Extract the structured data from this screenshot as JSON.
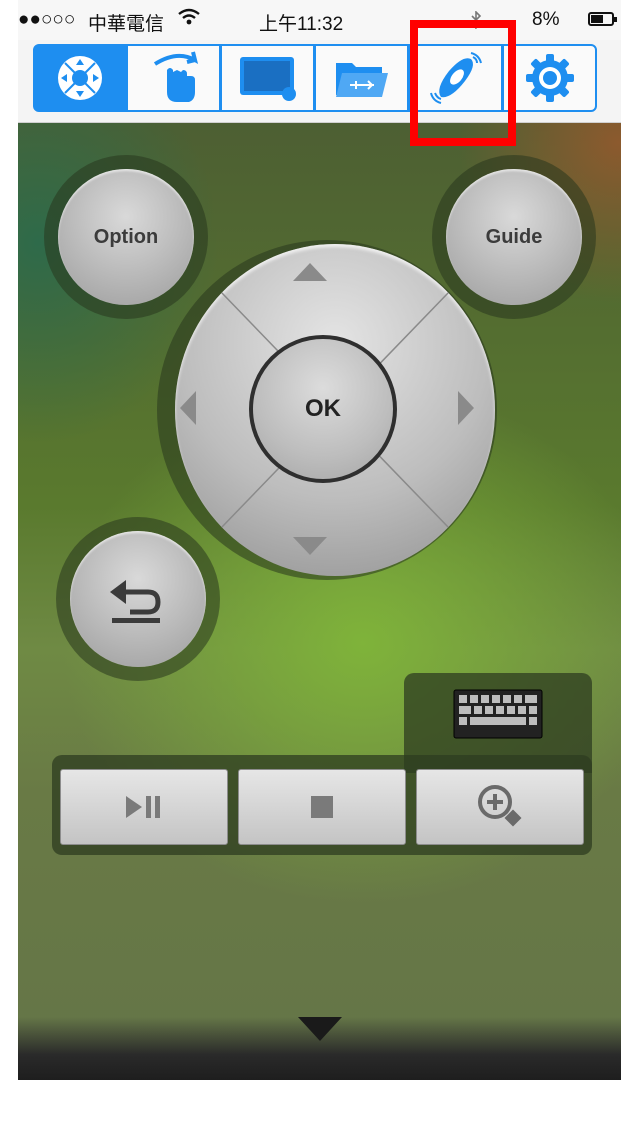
{
  "status_bar": {
    "signal": "●●○○○",
    "carrier": "中華電信",
    "wifi": "wifi-icon",
    "time": "上午11:32",
    "bluetooth": "bluetooth-icon",
    "battery_percent": "8%",
    "battery_icon": "battery-icon"
  },
  "toolbar": {
    "tabs": [
      {
        "name": "remote-tab",
        "icon": "dpad-icon",
        "active": true
      },
      {
        "name": "touchpad-tab",
        "icon": "hand-swipe-icon",
        "active": false
      },
      {
        "name": "screen-tab",
        "icon": "monitor-icon",
        "active": false
      },
      {
        "name": "media-folder-tab",
        "icon": "usb-folder-icon",
        "active": false
      },
      {
        "name": "motion-tab",
        "icon": "motion-remote-icon",
        "active": false
      },
      {
        "name": "settings-tab",
        "icon": "gear-icon",
        "active": false
      }
    ],
    "accent_color": "#1e8ef0"
  },
  "highlight_color": "#ff0000",
  "remote": {
    "option_label": "Option",
    "guide_label": "Guide",
    "ok_label": "OK",
    "back_icon": "return-arrow-icon",
    "keyboard_icon": "keyboard-icon"
  },
  "media_controls": [
    {
      "name": "play-pause-button",
      "icon": "play-pause-icon"
    },
    {
      "name": "stop-button",
      "icon": "stop-icon"
    },
    {
      "name": "zoom-button",
      "icon": "zoom-in-icon"
    }
  ],
  "bottom_bar": {
    "icon": "triangle-down-icon"
  }
}
